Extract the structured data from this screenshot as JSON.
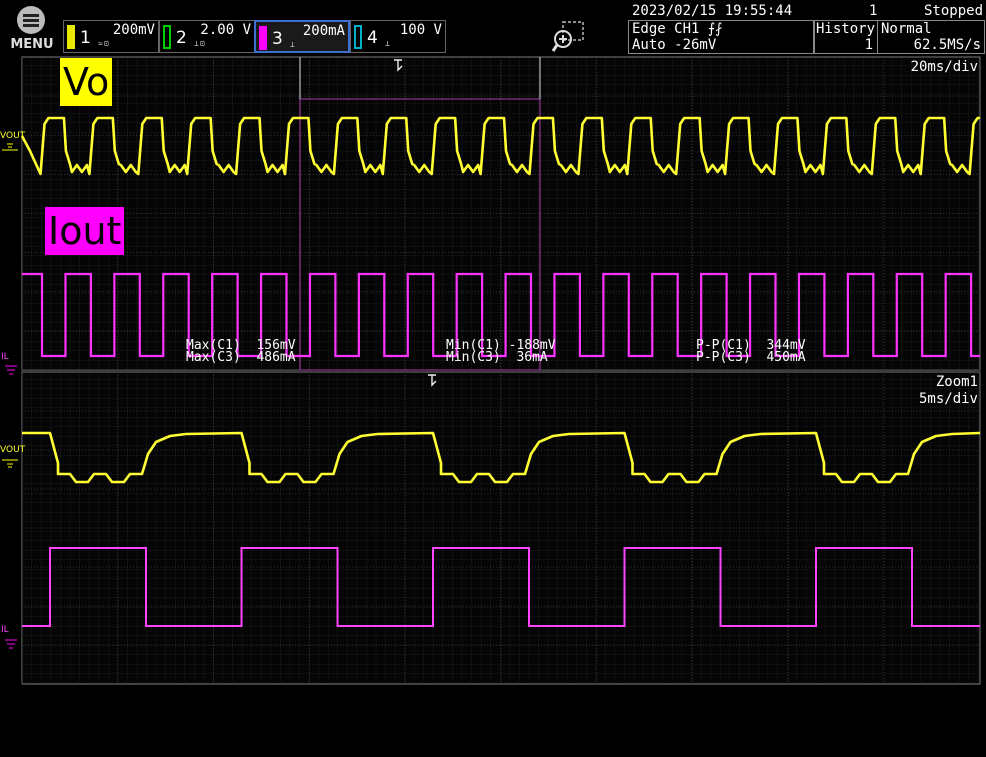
{
  "menu": {
    "label": "MENU",
    "icon": "menu-icon"
  },
  "channels": [
    {
      "num": "1",
      "scale": "200mV",
      "color": "#ffff00",
      "selected": false
    },
    {
      "num": "2",
      "scale": "2.00 V",
      "color": "#00ff00",
      "selected": false
    },
    {
      "num": "3",
      "scale": "200mA",
      "color": "#ff22ff",
      "selected": true
    },
    {
      "num": "4",
      "scale": "100 V",
      "color": "#00aaff",
      "selected": false
    }
  ],
  "status": {
    "datetime": "2023/02/15 19:55:44",
    "count": "1",
    "state": "Stopped",
    "trigger_type": "Edge CH1 ⨍⨏",
    "trigger_mode": "Auto -26mV",
    "history_label": "History",
    "history_value": "1",
    "acq_mode": "Normal",
    "sample_rate": "62.5MS/s"
  },
  "main_panel": {
    "timebase": "20ms/div",
    "vo_label": "Vo",
    "iout_label": "Iout",
    "ch1_marker": "VOUT",
    "ch3_marker": "IL"
  },
  "zoom_panel": {
    "name": "Zoom1",
    "timebase": "5ms/div",
    "ch1_marker": "VOUT",
    "ch3_marker": "IL"
  },
  "measurements": [
    {
      "l1": "Max(C1)",
      "v1": "156mV",
      "l2": "Max(C3)",
      "v2": "486mA"
    },
    {
      "l1": "Min(C1)",
      "v1": "-188mV",
      "l2": "Min(C3)",
      "v2": "36mA"
    },
    {
      "l1": "P-P(C1)",
      "v1": "344mV",
      "l2": "P-P(C3)",
      "v2": "450mA"
    }
  ],
  "colors": {
    "ch1": "#ffff33",
    "ch3": "#ff33ff",
    "grid": "#3a3a3a",
    "zoom_box": "#cc44cc",
    "vo_bg": "#ffff00",
    "iout_bg": "#ff00ff"
  }
}
